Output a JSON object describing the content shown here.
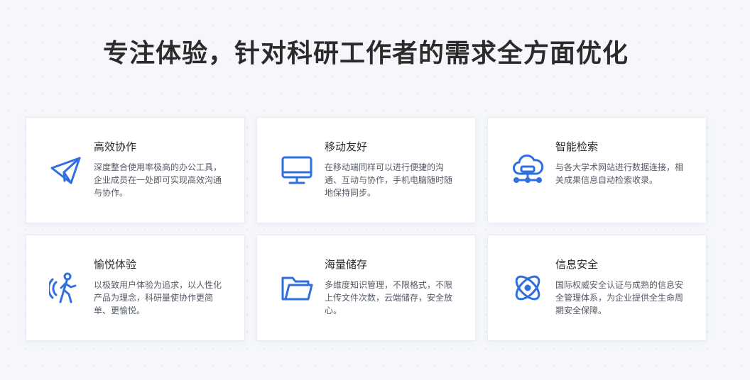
{
  "header": {
    "title": "专注体验，针对科研工作者的需求全方面优化"
  },
  "colors": {
    "accent": "#2f6fdf",
    "title": "#2b2b2b",
    "text": "#555a66"
  },
  "cards": [
    {
      "title": "高效协作",
      "desc": "深度整合使用率极高的办公工具，企业成员在一处即可实现高效沟通与协作。",
      "icon": "paper-plane-icon"
    },
    {
      "title": "移动友好",
      "desc": "在移动端同样可以进行便捷的沟通、互动与协作，手机电脑随时随地保持同步。",
      "icon": "monitor-icon"
    },
    {
      "title": "智能检索",
      "desc": "与各大学术网站进行数据连接，相关成果信息自动检索收录。",
      "icon": "cloud-network-icon"
    },
    {
      "title": "愉悦体验",
      "desc": "以极致用户体验为追求，以人性化产品为理念，科研量使协作更简单、更愉悦。",
      "icon": "person-walking-icon"
    },
    {
      "title": "海量储存",
      "desc": "多维度知识管理，不限格式，不限上传文件次数，云端储存，安全放心。",
      "icon": "folder-icon"
    },
    {
      "title": "信息安全",
      "desc": "国际权威安全认证与成熟的信息安全管理体系，为企业提供全生命周期安全保障。",
      "icon": "atom-shield-icon"
    }
  ]
}
